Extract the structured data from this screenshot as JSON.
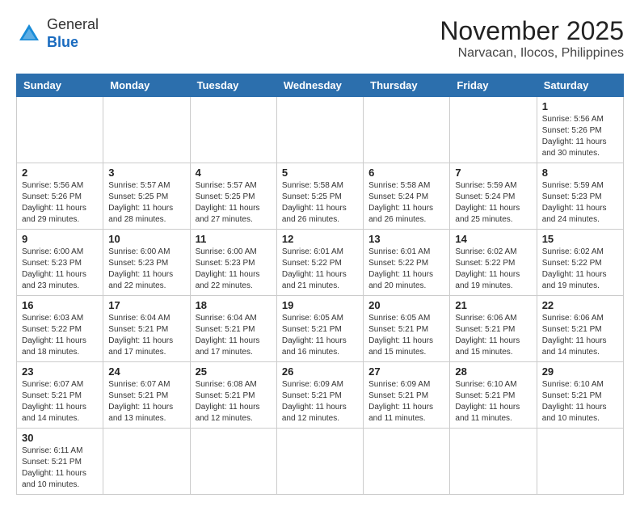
{
  "logo": {
    "general": "General",
    "blue": "Blue"
  },
  "title": "November 2025",
  "location": "Narvacan, Ilocos, Philippines",
  "weekdays": [
    "Sunday",
    "Monday",
    "Tuesday",
    "Wednesday",
    "Thursday",
    "Friday",
    "Saturday"
  ],
  "weeks": [
    [
      {
        "day": null,
        "content": null
      },
      {
        "day": null,
        "content": null
      },
      {
        "day": null,
        "content": null
      },
      {
        "day": null,
        "content": null
      },
      {
        "day": null,
        "content": null
      },
      {
        "day": null,
        "content": null
      },
      {
        "day": "1",
        "content": "Sunrise: 5:56 AM\nSunset: 5:26 PM\nDaylight: 11 hours\nand 30 minutes."
      }
    ],
    [
      {
        "day": "2",
        "content": "Sunrise: 5:56 AM\nSunset: 5:26 PM\nDaylight: 11 hours\nand 29 minutes."
      },
      {
        "day": "3",
        "content": "Sunrise: 5:57 AM\nSunset: 5:25 PM\nDaylight: 11 hours\nand 28 minutes."
      },
      {
        "day": "4",
        "content": "Sunrise: 5:57 AM\nSunset: 5:25 PM\nDaylight: 11 hours\nand 27 minutes."
      },
      {
        "day": "5",
        "content": "Sunrise: 5:58 AM\nSunset: 5:25 PM\nDaylight: 11 hours\nand 26 minutes."
      },
      {
        "day": "6",
        "content": "Sunrise: 5:58 AM\nSunset: 5:24 PM\nDaylight: 11 hours\nand 26 minutes."
      },
      {
        "day": "7",
        "content": "Sunrise: 5:59 AM\nSunset: 5:24 PM\nDaylight: 11 hours\nand 25 minutes."
      },
      {
        "day": "8",
        "content": "Sunrise: 5:59 AM\nSunset: 5:23 PM\nDaylight: 11 hours\nand 24 minutes."
      }
    ],
    [
      {
        "day": "9",
        "content": "Sunrise: 6:00 AM\nSunset: 5:23 PM\nDaylight: 11 hours\nand 23 minutes."
      },
      {
        "day": "10",
        "content": "Sunrise: 6:00 AM\nSunset: 5:23 PM\nDaylight: 11 hours\nand 22 minutes."
      },
      {
        "day": "11",
        "content": "Sunrise: 6:00 AM\nSunset: 5:23 PM\nDaylight: 11 hours\nand 22 minutes."
      },
      {
        "day": "12",
        "content": "Sunrise: 6:01 AM\nSunset: 5:22 PM\nDaylight: 11 hours\nand 21 minutes."
      },
      {
        "day": "13",
        "content": "Sunrise: 6:01 AM\nSunset: 5:22 PM\nDaylight: 11 hours\nand 20 minutes."
      },
      {
        "day": "14",
        "content": "Sunrise: 6:02 AM\nSunset: 5:22 PM\nDaylight: 11 hours\nand 19 minutes."
      },
      {
        "day": "15",
        "content": "Sunrise: 6:02 AM\nSunset: 5:22 PM\nDaylight: 11 hours\nand 19 minutes."
      }
    ],
    [
      {
        "day": "16",
        "content": "Sunrise: 6:03 AM\nSunset: 5:22 PM\nDaylight: 11 hours\nand 18 minutes."
      },
      {
        "day": "17",
        "content": "Sunrise: 6:04 AM\nSunset: 5:21 PM\nDaylight: 11 hours\nand 17 minutes."
      },
      {
        "day": "18",
        "content": "Sunrise: 6:04 AM\nSunset: 5:21 PM\nDaylight: 11 hours\nand 17 minutes."
      },
      {
        "day": "19",
        "content": "Sunrise: 6:05 AM\nSunset: 5:21 PM\nDaylight: 11 hours\nand 16 minutes."
      },
      {
        "day": "20",
        "content": "Sunrise: 6:05 AM\nSunset: 5:21 PM\nDaylight: 11 hours\nand 15 minutes."
      },
      {
        "day": "21",
        "content": "Sunrise: 6:06 AM\nSunset: 5:21 PM\nDaylight: 11 hours\nand 15 minutes."
      },
      {
        "day": "22",
        "content": "Sunrise: 6:06 AM\nSunset: 5:21 PM\nDaylight: 11 hours\nand 14 minutes."
      }
    ],
    [
      {
        "day": "23",
        "content": "Sunrise: 6:07 AM\nSunset: 5:21 PM\nDaylight: 11 hours\nand 14 minutes."
      },
      {
        "day": "24",
        "content": "Sunrise: 6:07 AM\nSunset: 5:21 PM\nDaylight: 11 hours\nand 13 minutes."
      },
      {
        "day": "25",
        "content": "Sunrise: 6:08 AM\nSunset: 5:21 PM\nDaylight: 11 hours\nand 12 minutes."
      },
      {
        "day": "26",
        "content": "Sunrise: 6:09 AM\nSunset: 5:21 PM\nDaylight: 11 hours\nand 12 minutes."
      },
      {
        "day": "27",
        "content": "Sunrise: 6:09 AM\nSunset: 5:21 PM\nDaylight: 11 hours\nand 11 minutes."
      },
      {
        "day": "28",
        "content": "Sunrise: 6:10 AM\nSunset: 5:21 PM\nDaylight: 11 hours\nand 11 minutes."
      },
      {
        "day": "29",
        "content": "Sunrise: 6:10 AM\nSunset: 5:21 PM\nDaylight: 11 hours\nand 10 minutes."
      }
    ],
    [
      {
        "day": "30",
        "content": "Sunrise: 6:11 AM\nSunset: 5:21 PM\nDaylight: 11 hours\nand 10 minutes."
      },
      {
        "day": null,
        "content": null
      },
      {
        "day": null,
        "content": null
      },
      {
        "day": null,
        "content": null
      },
      {
        "day": null,
        "content": null
      },
      {
        "day": null,
        "content": null
      },
      {
        "day": null,
        "content": null
      }
    ]
  ]
}
